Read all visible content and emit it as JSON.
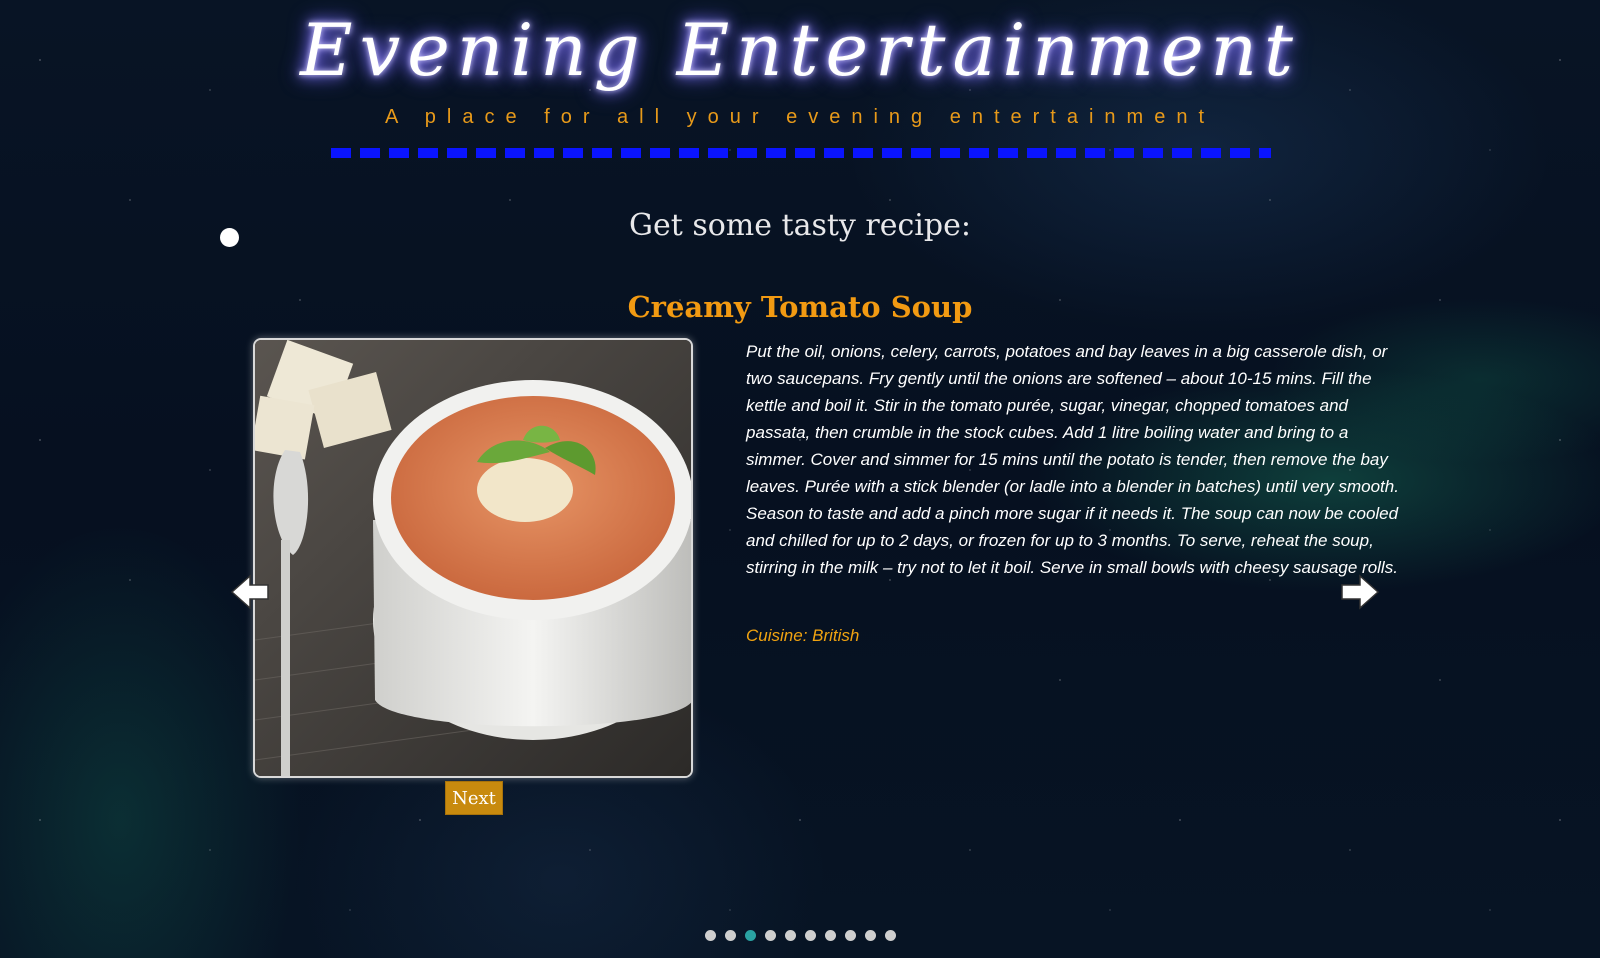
{
  "header": {
    "title": "Evening Entertainment",
    "tagline": "A place for all your evening entertainment"
  },
  "section": {
    "heading": "Get some tasty recipe:"
  },
  "recipe": {
    "title": "Creamy Tomato Soup",
    "instructions": "Put the oil, onions, celery, carrots, potatoes and bay leaves in a big casserole dish, or two saucepans. Fry gently until the onions are softened – about 10-15 mins. Fill the kettle and boil it. Stir in the tomato purée, sugar, vinegar, chopped tomatoes and passata, then crumble in the stock cubes. Add 1 litre boiling water and bring to a simmer. Cover and simmer for 15 mins until the potato is tender, then remove the bay leaves. Purée with a stick blender (or ladle into a blender in batches) until very smooth. Season to taste and add a pinch more sugar if it needs it. The soup can now be cooled and chilled for up to 2 days, or frozen for up to 3 months. To serve, reheat the soup, stirring in the milk – try not to let it boil. Serve in small bowls with cheesy sausage rolls.",
    "cuisine_label": "Cuisine:",
    "cuisine_value": "British",
    "next_label": "Next"
  },
  "navigation": {
    "prev_icon": "arrow-left-icon",
    "next_icon": "arrow-right-icon"
  },
  "pagination": {
    "total": 10,
    "active_index": 2
  },
  "colors": {
    "accent": "#f29a12",
    "title_rule": "#0a14ff",
    "active_dot": "#2aa3a3"
  }
}
